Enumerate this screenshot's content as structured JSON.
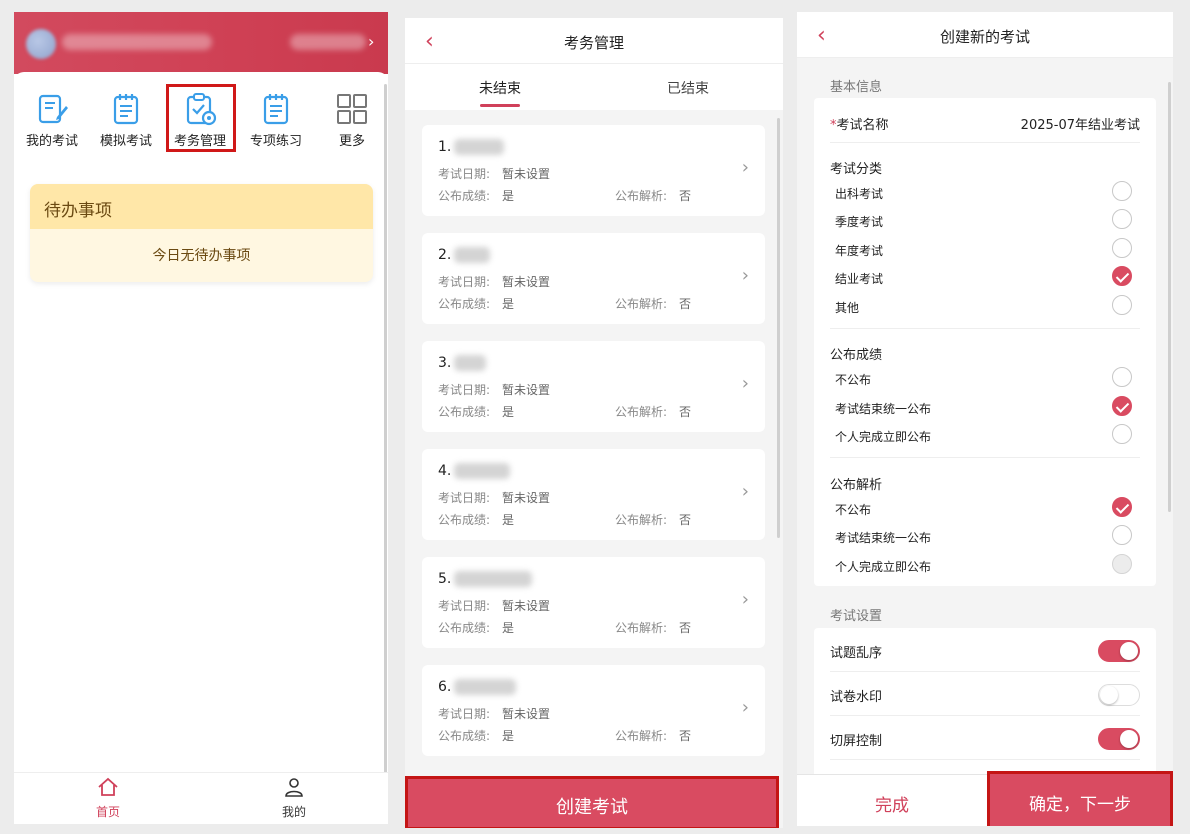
{
  "home": {
    "nav": [
      {
        "label": "我的考试",
        "icon": "edit-doc-icon"
      },
      {
        "label": "模拟考试",
        "icon": "notepad-icon"
      },
      {
        "label": "考务管理",
        "icon": "clipboard-gear-icon"
      },
      {
        "label": "专项练习",
        "icon": "notepad-icon"
      },
      {
        "label": "更多",
        "icon": "grid-icon"
      }
    ],
    "todo_title": "待办事项",
    "todo_empty": "今日无待办事项",
    "tabbar": [
      {
        "label": "首页",
        "icon": "home-icon"
      },
      {
        "label": "我的",
        "icon": "user-icon"
      }
    ],
    "accent": "#d0405a"
  },
  "exam_admin": {
    "title": "考务管理",
    "tabs": [
      "未结束",
      "已结束"
    ],
    "date_label": "考试日期:",
    "score_label": "公布成绩:",
    "analysis_label": "公布解析:",
    "items": [
      {
        "index": "1.",
        "date": "暂未设置",
        "score": "是",
        "analysis": "否"
      },
      {
        "index": "2.",
        "date": "暂未设置",
        "score": "是",
        "analysis": "否"
      },
      {
        "index": "3.",
        "date": "暂未设置",
        "score": "是",
        "analysis": "否"
      },
      {
        "index": "4.",
        "date": "暂未设置",
        "score": "是",
        "analysis": "否"
      },
      {
        "index": "5.",
        "date": "暂未设置",
        "score": "是",
        "analysis": "否"
      },
      {
        "index": "6.",
        "date": "暂未设置",
        "score": "是",
        "analysis": "否"
      }
    ],
    "create_button": "创建考试"
  },
  "create_exam": {
    "title": "创建新的考试",
    "basic_info": "基本信息",
    "exam_name_label": "考试名称",
    "exam_name_value": "2025-07年结业考试",
    "category_label": "考试分类",
    "categories": [
      {
        "label": "出科考试",
        "checked": false
      },
      {
        "label": "季度考试",
        "checked": false
      },
      {
        "label": "年度考试",
        "checked": false
      },
      {
        "label": "结业考试",
        "checked": true
      },
      {
        "label": "其他",
        "checked": false
      }
    ],
    "publish_score_label": "公布成绩",
    "publish_score_options": [
      {
        "label": "不公布",
        "checked": false
      },
      {
        "label": "考试结束统一公布",
        "checked": true
      },
      {
        "label": "个人完成立即公布",
        "checked": false
      }
    ],
    "publish_analysis_label": "公布解析",
    "publish_analysis_options": [
      {
        "label": "不公布",
        "checked": true
      },
      {
        "label": "考试结束统一公布",
        "checked": false
      },
      {
        "label": "个人完成立即公布",
        "checked": false,
        "disabled": true
      }
    ],
    "settings_label": "考试设置",
    "settings": [
      {
        "label": "试题乱序",
        "on": true
      },
      {
        "label": "试卷水印",
        "on": false
      },
      {
        "label": "切屏控制",
        "on": true
      }
    ],
    "done_button": "完成",
    "next_button": "确定，下一步"
  }
}
